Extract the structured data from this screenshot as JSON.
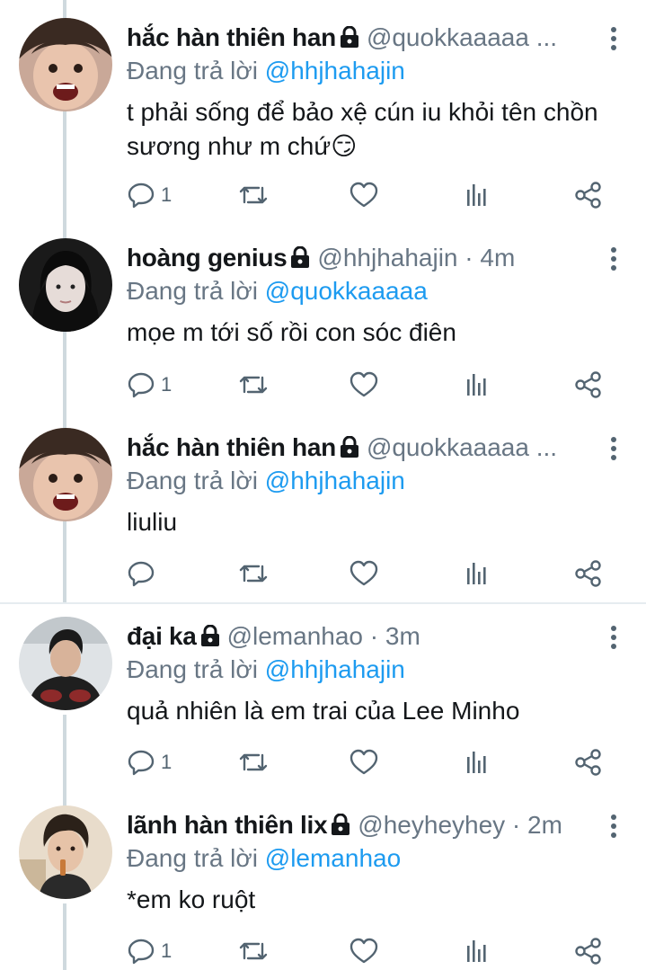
{
  "reply_prefix": "Đang trả lời",
  "tweets": [
    {
      "name": "hắc hàn thiên han",
      "handle": "@quokkaaaaa ...",
      "reply_to": "@hhjhahajin",
      "text": "t phải sống để bảo xệ cún iu khỏi tên chồn sương như m chứ😏",
      "reply_count": "1"
    },
    {
      "name": "hoàng genius",
      "handle": "@hhjhahajin · 4m",
      "reply_to": "@quokkaaaaa",
      "text": "mọe m tới số rồi con sóc điên",
      "reply_count": "1"
    },
    {
      "name": "hắc hàn thiên han",
      "handle": "@quokkaaaaa ...",
      "reply_to": "@hhjhahajin",
      "text": "liuliu",
      "reply_count": ""
    },
    {
      "name": "đại ka",
      "handle": "@lemanhao · 3m",
      "reply_to": "@hhjhahajin",
      "text": "quả nhiên là em trai của Lee Minho",
      "reply_count": "1"
    },
    {
      "name": "lãnh hàn thiên lix",
      "handle": "@heyheyhey · 2m",
      "reply_to": "@lemanhao",
      "text": "*em ko ruột",
      "reply_count": "1"
    }
  ],
  "icons": {
    "reply": "comment-icon",
    "retweet": "retweet-icon",
    "like": "heart-icon",
    "views": "bar-chart-icon",
    "share": "share-icon",
    "protected": "lock-icon",
    "more": "more-vertical-icon"
  },
  "colors": {
    "mention": "#1d9bf0",
    "secondary_text": "#687684",
    "icon": "#536471",
    "thread_line": "#cfd9de"
  }
}
